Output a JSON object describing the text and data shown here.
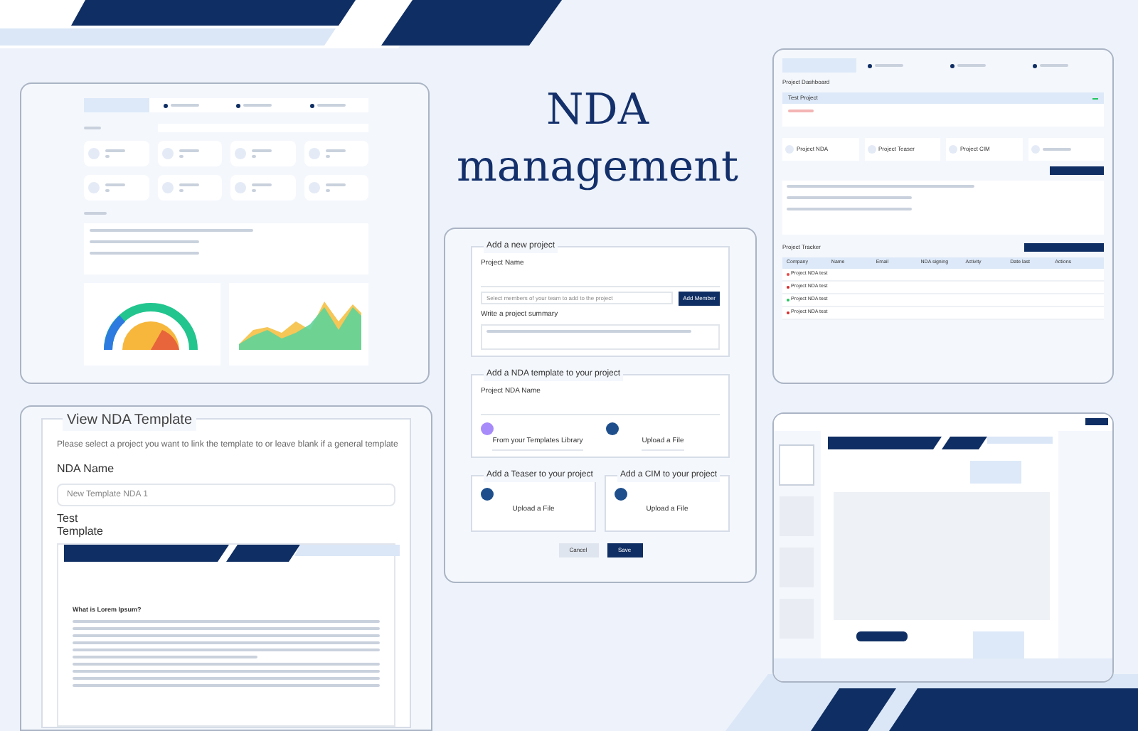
{
  "title": {
    "line_1": "NDA",
    "line_2": "management"
  },
  "project_form": {
    "new_project": {
      "legend": "Add a new project",
      "name_label": "Project Name",
      "members_placeholder": "Select members of your team to add to the project",
      "add_member_button": "Add Member",
      "summary_label": "Write a project summary"
    },
    "nda_template": {
      "legend": "Add a NDA template to your project",
      "name_label": "Project NDA Name",
      "options": [
        {
          "label": "From your Templates Library",
          "color": "#a78bfa"
        },
        {
          "label": "Upload a File",
          "color": "#1e4f8c"
        }
      ]
    },
    "uploads": [
      {
        "legend": "Add a Teaser to your project",
        "label": "Upload a File"
      },
      {
        "legend": "Add a CIM to your project",
        "label": "Upload a File"
      }
    ],
    "buttons": {
      "cancel": "Cancel",
      "save": "Save"
    }
  },
  "template_view": {
    "legend": "View NDA Template",
    "hint": "Please select a project you want to link the template to or leave blank if a general template",
    "name_label": "NDA Name",
    "name_value": "New Template NDA 1",
    "template_label": "Test Template",
    "doc_heading": "What is Lorem Ipsum?"
  },
  "project_dashboard": {
    "heading": "Project Dashboard",
    "project": "Test Project",
    "files": [
      "Project NDA",
      "Project Teaser",
      "Project CIM"
    ],
    "tracker_heading": "Project Tracker",
    "columns": [
      "Company",
      "Name",
      "Email",
      "NDA signing",
      "Activity",
      "Date last",
      "Actions"
    ],
    "rows": [
      {
        "company": "Project NDA test",
        "color": "#ef4444"
      },
      {
        "company": "Project NDA test",
        "color": "#dc2626"
      },
      {
        "company": "Project NDA test",
        "color": "#22c55e"
      },
      {
        "company": "Project NDA test",
        "color": "#dc2626"
      }
    ]
  }
}
